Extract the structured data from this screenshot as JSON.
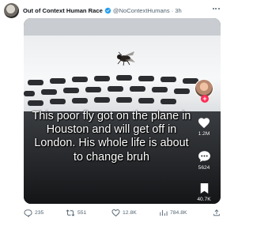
{
  "tweet": {
    "display_name": "Out of Context Human Race",
    "handle": "@NoContextHumans",
    "separator": "·",
    "time": "3h",
    "caption": "This poor fly got on the plane in Houston and will get off in London. His whole life is about to change bruh"
  },
  "tiktok": {
    "likes": "1.2M",
    "comments": "5624",
    "saves": "40.7K"
  },
  "actions": {
    "replies": "235",
    "retweets": "551",
    "likes": "12.8K",
    "views": "784.8K"
  },
  "colors": {
    "verified": "#1d9bf0",
    "follow": "#fe2c55",
    "secondary_text": "#536471"
  }
}
